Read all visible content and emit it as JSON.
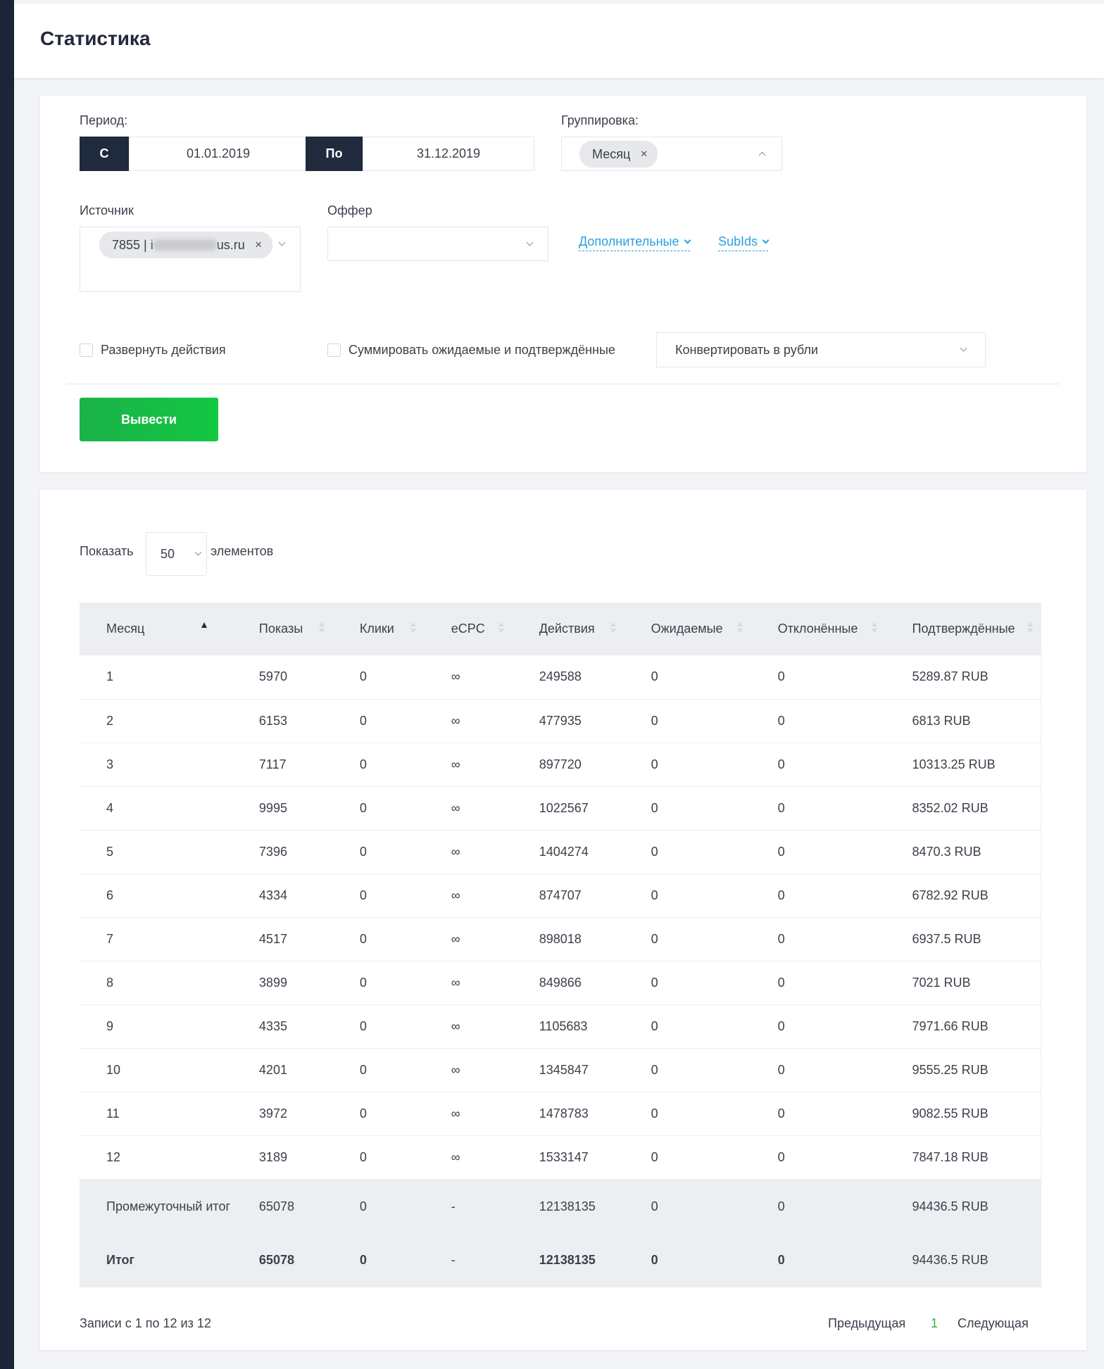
{
  "page": {
    "title": "Статистика"
  },
  "filters": {
    "period_label": "Период:",
    "from_prefix": "С",
    "from_value": "01.01.2019",
    "to_prefix": "По",
    "to_value": "31.12.2019",
    "grouping_label": "Группировка:",
    "grouping_chip": "Месяц",
    "source_label": "Источник",
    "source_chip_prefix": "7855 | i",
    "source_chip_suffix": "us.ru",
    "offer_label": "Оффер",
    "extra_link": "Дополнительные",
    "subids_link": "SubIds",
    "expand_actions": "Развернуть действия",
    "sum_pending": "Суммировать ожидаемые и подтверждённые",
    "convert_select": "Конвертировать в рубли",
    "submit": "Вывести"
  },
  "length": {
    "show": "Показать",
    "value": "50",
    "elements": "элементов"
  },
  "table": {
    "columns": [
      "Месяц",
      "Показы",
      "Клики",
      "eCPC",
      "Действия",
      "Ожидаемые",
      "Отклонённые",
      "Подтверждённые"
    ],
    "rows": [
      [
        "1",
        "5970",
        "0",
        "∞",
        "249588",
        "0",
        "0",
        "5289.87 RUB"
      ],
      [
        "2",
        "6153",
        "0",
        "∞",
        "477935",
        "0",
        "0",
        "6813 RUB"
      ],
      [
        "3",
        "7117",
        "0",
        "∞",
        "897720",
        "0",
        "0",
        "10313.25 RUB"
      ],
      [
        "4",
        "9995",
        "0",
        "∞",
        "1022567",
        "0",
        "0",
        "8352.02 RUB"
      ],
      [
        "5",
        "7396",
        "0",
        "∞",
        "1404274",
        "0",
        "0",
        "8470.3 RUB"
      ],
      [
        "6",
        "4334",
        "0",
        "∞",
        "874707",
        "0",
        "0",
        "6782.92 RUB"
      ],
      [
        "7",
        "4517",
        "0",
        "∞",
        "898018",
        "0",
        "0",
        "6937.5 RUB"
      ],
      [
        "8",
        "3899",
        "0",
        "∞",
        "849866",
        "0",
        "0",
        "7021 RUB"
      ],
      [
        "9",
        "4335",
        "0",
        "∞",
        "1105683",
        "0",
        "0",
        "7971.66 RUB"
      ],
      [
        "10",
        "4201",
        "0",
        "∞",
        "1345847",
        "0",
        "0",
        "9555.25 RUB"
      ],
      [
        "11",
        "3972",
        "0",
        "∞",
        "1478783",
        "0",
        "0",
        "9082.55 RUB"
      ],
      [
        "12",
        "3189",
        "0",
        "∞",
        "1533147",
        "0",
        "0",
        "7847.18 RUB"
      ]
    ],
    "subtotal": [
      "Промежуточный итог",
      "65078",
      "0",
      "-",
      "12138135",
      "0",
      "0",
      "94436.5 RUB"
    ],
    "total": [
      "Итог",
      "65078",
      "0",
      "-",
      "12138135",
      "0",
      "0",
      "94436.5 RUB"
    ]
  },
  "footer": {
    "info": "Записи с 1 по 12 из 12",
    "prev": "Предыдущая",
    "page": "1",
    "next": "Следующая"
  },
  "colors": {
    "sidebar": "#1b2438",
    "accent_green": "#12c742",
    "link_blue": "#2b9fe0"
  }
}
